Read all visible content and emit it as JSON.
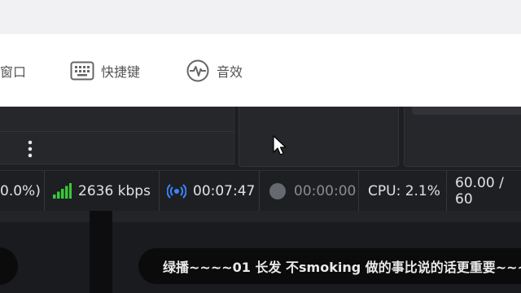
{
  "menu": {
    "window_label": "窗口",
    "shortcuts_label": "快捷键",
    "audio_label": "音效"
  },
  "status": {
    "dropped": "0.0%)",
    "bitrate": "2636 kbps",
    "stream_time": "00:07:47",
    "record_time": "00:00:00",
    "cpu": "CPU: 2.1%",
    "fps": "60.00 / 60"
  },
  "caption": {
    "text": "绿播~~~~01 长发 不smoking   做的事比说的话更重要~~~"
  },
  "colors": {
    "signal": "#39c939",
    "stream_icon": "#3a86ff",
    "record_dot": "#666a70"
  }
}
